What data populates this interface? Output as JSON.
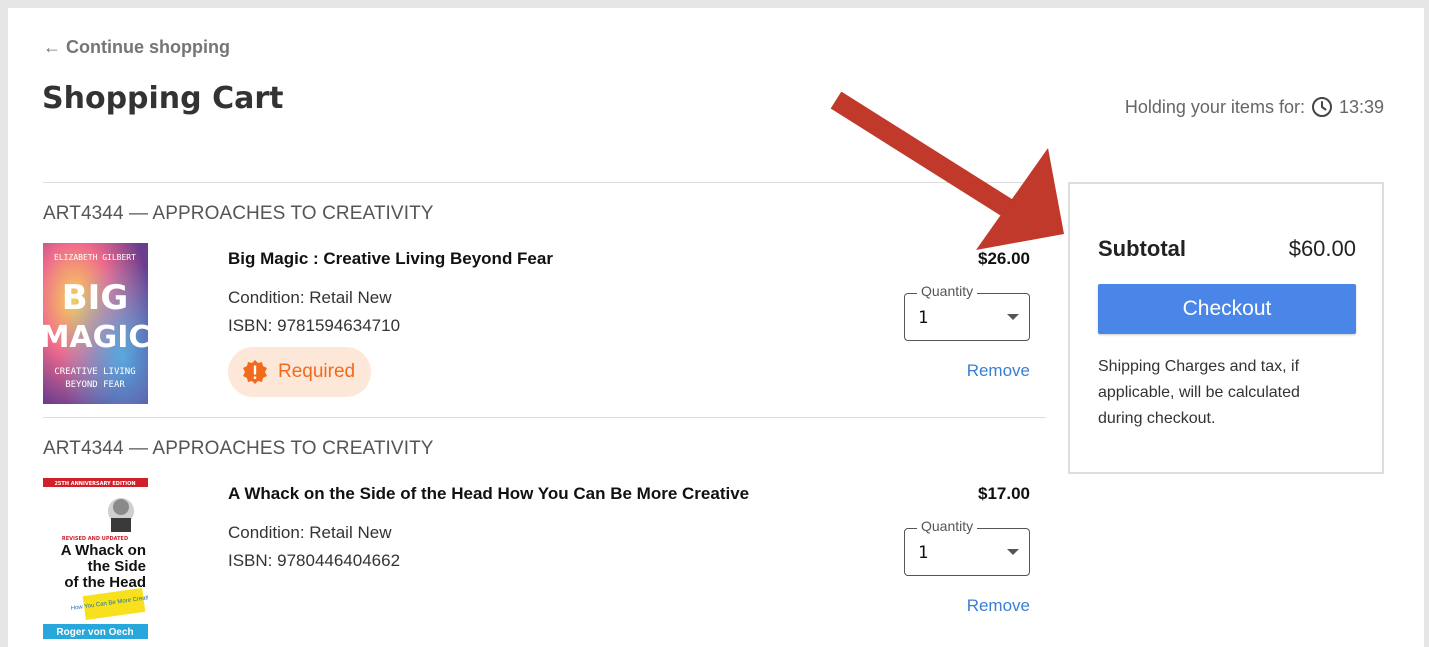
{
  "nav": {
    "continue_label": "← Continue shopping"
  },
  "header": {
    "title": "Shopping Cart",
    "holding_label": "Holding your items for:",
    "holding_time": "13:39",
    "clock_icon": "clock-icon"
  },
  "cart": {
    "items": [
      {
        "course": "ART4344 — APPROACHES TO CREATIVITY",
        "title": "Big Magic : Creative Living Beyond Fear",
        "condition": "Condition: Retail New",
        "isbn": "ISBN: 9781594634710",
        "price": "$26.00",
        "quantity_label": "Quantity",
        "quantity": "1",
        "remove_label": "Remove",
        "badge": "Required",
        "cover": {
          "author": "ELIZABETH GILBERT",
          "line1": "BIG",
          "line2": "MAGIC",
          "subtitle1": "CREATIVE LIVING",
          "subtitle2": "BEYOND FEAR"
        }
      },
      {
        "course": "ART4344 — APPROACHES TO CREATIVITY",
        "title": "A Whack on the Side of the Head How You Can Be More Creative",
        "condition": "Condition: Retail New",
        "isbn": "ISBN: 9780446404662",
        "price": "$17.00",
        "quantity_label": "Quantity",
        "quantity": "1",
        "remove_label": "Remove",
        "cover": {
          "banner": "25TH ANNIVERSARY EDITION",
          "tag": "REVISED AND UPDATED",
          "title1": "A Whack on",
          "title2": "the Side",
          "title3": "of the Head",
          "sticker": "How You Can Be More Creative",
          "author": "Roger von Oech"
        }
      }
    ]
  },
  "summary": {
    "subtotal_label": "Subtotal",
    "subtotal_value": "$60.00",
    "checkout_label": "Checkout",
    "note": "Shipping Charges and tax, if applicable, will be calculated during checkout."
  },
  "colors": {
    "accent": "#4a86e8",
    "link": "#3a7fd5",
    "required": "#f26b1d",
    "required_bg": "#fde7d9",
    "annotation_arrow": "#c0392b"
  }
}
